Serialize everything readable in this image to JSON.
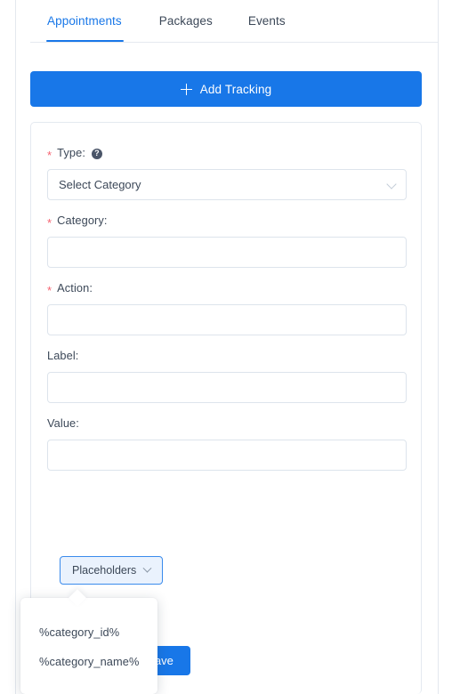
{
  "panel": {
    "tabs": [
      {
        "label": "Appointments",
        "active": true
      },
      {
        "label": "Packages",
        "active": false
      },
      {
        "label": "Events",
        "active": false
      }
    ],
    "add_tracking": {
      "label": "Add Tracking",
      "icon": "plus-icon"
    }
  },
  "form": {
    "fields": [
      {
        "name": "type",
        "label": "Type:",
        "required": true,
        "required_marker": "*",
        "has_help": true,
        "help_glyph": "?",
        "kind": "select",
        "value": "Select Category",
        "chevron": "chevron-down-icon"
      },
      {
        "name": "category",
        "label": "Category:",
        "required": true,
        "required_marker": "*",
        "has_help": false,
        "kind": "text",
        "value": "",
        "placeholder": ""
      },
      {
        "name": "action",
        "label": "Action:",
        "required": true,
        "required_marker": "*",
        "has_help": false,
        "kind": "text",
        "value": "",
        "placeholder": ""
      },
      {
        "name": "label",
        "label": "Label:",
        "required": false,
        "required_marker": "",
        "has_help": false,
        "kind": "text",
        "value": "",
        "placeholder": ""
      },
      {
        "name": "value",
        "label": "Value:",
        "required": false,
        "required_marker": "",
        "has_help": false,
        "kind": "text",
        "value": "",
        "placeholder": ""
      }
    ],
    "placeholders_button": {
      "label": "Placeholders",
      "chevron": "chevron-down-icon"
    },
    "submit_button": {
      "label": "Save"
    }
  },
  "placeholders_menu": {
    "items": [
      {
        "label": "%category_id%"
      },
      {
        "label": "%category_name%"
      }
    ]
  },
  "colors": {
    "accent": "#1877e8",
    "required": "#f5616f",
    "text": "#3c4858",
    "border": "#dde4ec",
    "popover_bg": "#ffffff",
    "placeholder_btn_bg": "#eaf2fd"
  }
}
